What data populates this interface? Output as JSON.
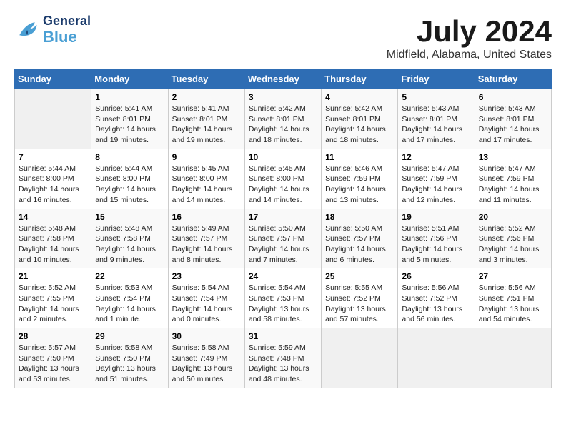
{
  "header": {
    "logo_general": "General",
    "logo_blue": "Blue",
    "month_title": "July 2024",
    "location": "Midfield, Alabama, United States"
  },
  "weekdays": [
    "Sunday",
    "Monday",
    "Tuesday",
    "Wednesday",
    "Thursday",
    "Friday",
    "Saturday"
  ],
  "weeks": [
    [
      {
        "day": "",
        "empty": true
      },
      {
        "day": "1",
        "sunrise": "Sunrise: 5:41 AM",
        "sunset": "Sunset: 8:01 PM",
        "daylight": "Daylight: 14 hours and 19 minutes."
      },
      {
        "day": "2",
        "sunrise": "Sunrise: 5:41 AM",
        "sunset": "Sunset: 8:01 PM",
        "daylight": "Daylight: 14 hours and 19 minutes."
      },
      {
        "day": "3",
        "sunrise": "Sunrise: 5:42 AM",
        "sunset": "Sunset: 8:01 PM",
        "daylight": "Daylight: 14 hours and 18 minutes."
      },
      {
        "day": "4",
        "sunrise": "Sunrise: 5:42 AM",
        "sunset": "Sunset: 8:01 PM",
        "daylight": "Daylight: 14 hours and 18 minutes."
      },
      {
        "day": "5",
        "sunrise": "Sunrise: 5:43 AM",
        "sunset": "Sunset: 8:01 PM",
        "daylight": "Daylight: 14 hours and 17 minutes."
      },
      {
        "day": "6",
        "sunrise": "Sunrise: 5:43 AM",
        "sunset": "Sunset: 8:01 PM",
        "daylight": "Daylight: 14 hours and 17 minutes."
      }
    ],
    [
      {
        "day": "7",
        "sunrise": "Sunrise: 5:44 AM",
        "sunset": "Sunset: 8:00 PM",
        "daylight": "Daylight: 14 hours and 16 minutes."
      },
      {
        "day": "8",
        "sunrise": "Sunrise: 5:44 AM",
        "sunset": "Sunset: 8:00 PM",
        "daylight": "Daylight: 14 hours and 15 minutes."
      },
      {
        "day": "9",
        "sunrise": "Sunrise: 5:45 AM",
        "sunset": "Sunset: 8:00 PM",
        "daylight": "Daylight: 14 hours and 14 minutes."
      },
      {
        "day": "10",
        "sunrise": "Sunrise: 5:45 AM",
        "sunset": "Sunset: 8:00 PM",
        "daylight": "Daylight: 14 hours and 14 minutes."
      },
      {
        "day": "11",
        "sunrise": "Sunrise: 5:46 AM",
        "sunset": "Sunset: 7:59 PM",
        "daylight": "Daylight: 14 hours and 13 minutes."
      },
      {
        "day": "12",
        "sunrise": "Sunrise: 5:47 AM",
        "sunset": "Sunset: 7:59 PM",
        "daylight": "Daylight: 14 hours and 12 minutes."
      },
      {
        "day": "13",
        "sunrise": "Sunrise: 5:47 AM",
        "sunset": "Sunset: 7:59 PM",
        "daylight": "Daylight: 14 hours and 11 minutes."
      }
    ],
    [
      {
        "day": "14",
        "sunrise": "Sunrise: 5:48 AM",
        "sunset": "Sunset: 7:58 PM",
        "daylight": "Daylight: 14 hours and 10 minutes."
      },
      {
        "day": "15",
        "sunrise": "Sunrise: 5:48 AM",
        "sunset": "Sunset: 7:58 PM",
        "daylight": "Daylight: 14 hours and 9 minutes."
      },
      {
        "day": "16",
        "sunrise": "Sunrise: 5:49 AM",
        "sunset": "Sunset: 7:57 PM",
        "daylight": "Daylight: 14 hours and 8 minutes."
      },
      {
        "day": "17",
        "sunrise": "Sunrise: 5:50 AM",
        "sunset": "Sunset: 7:57 PM",
        "daylight": "Daylight: 14 hours and 7 minutes."
      },
      {
        "day": "18",
        "sunrise": "Sunrise: 5:50 AM",
        "sunset": "Sunset: 7:57 PM",
        "daylight": "Daylight: 14 hours and 6 minutes."
      },
      {
        "day": "19",
        "sunrise": "Sunrise: 5:51 AM",
        "sunset": "Sunset: 7:56 PM",
        "daylight": "Daylight: 14 hours and 5 minutes."
      },
      {
        "day": "20",
        "sunrise": "Sunrise: 5:52 AM",
        "sunset": "Sunset: 7:56 PM",
        "daylight": "Daylight: 14 hours and 3 minutes."
      }
    ],
    [
      {
        "day": "21",
        "sunrise": "Sunrise: 5:52 AM",
        "sunset": "Sunset: 7:55 PM",
        "daylight": "Daylight: 14 hours and 2 minutes."
      },
      {
        "day": "22",
        "sunrise": "Sunrise: 5:53 AM",
        "sunset": "Sunset: 7:54 PM",
        "daylight": "Daylight: 14 hours and 1 minute."
      },
      {
        "day": "23",
        "sunrise": "Sunrise: 5:54 AM",
        "sunset": "Sunset: 7:54 PM",
        "daylight": "Daylight: 14 hours and 0 minutes."
      },
      {
        "day": "24",
        "sunrise": "Sunrise: 5:54 AM",
        "sunset": "Sunset: 7:53 PM",
        "daylight": "Daylight: 13 hours and 58 minutes."
      },
      {
        "day": "25",
        "sunrise": "Sunrise: 5:55 AM",
        "sunset": "Sunset: 7:52 PM",
        "daylight": "Daylight: 13 hours and 57 minutes."
      },
      {
        "day": "26",
        "sunrise": "Sunrise: 5:56 AM",
        "sunset": "Sunset: 7:52 PM",
        "daylight": "Daylight: 13 hours and 56 minutes."
      },
      {
        "day": "27",
        "sunrise": "Sunrise: 5:56 AM",
        "sunset": "Sunset: 7:51 PM",
        "daylight": "Daylight: 13 hours and 54 minutes."
      }
    ],
    [
      {
        "day": "28",
        "sunrise": "Sunrise: 5:57 AM",
        "sunset": "Sunset: 7:50 PM",
        "daylight": "Daylight: 13 hours and 53 minutes."
      },
      {
        "day": "29",
        "sunrise": "Sunrise: 5:58 AM",
        "sunset": "Sunset: 7:50 PM",
        "daylight": "Daylight: 13 hours and 51 minutes."
      },
      {
        "day": "30",
        "sunrise": "Sunrise: 5:58 AM",
        "sunset": "Sunset: 7:49 PM",
        "daylight": "Daylight: 13 hours and 50 minutes."
      },
      {
        "day": "31",
        "sunrise": "Sunrise: 5:59 AM",
        "sunset": "Sunset: 7:48 PM",
        "daylight": "Daylight: 13 hours and 48 minutes."
      },
      {
        "day": "",
        "empty": true
      },
      {
        "day": "",
        "empty": true
      },
      {
        "day": "",
        "empty": true
      }
    ]
  ]
}
